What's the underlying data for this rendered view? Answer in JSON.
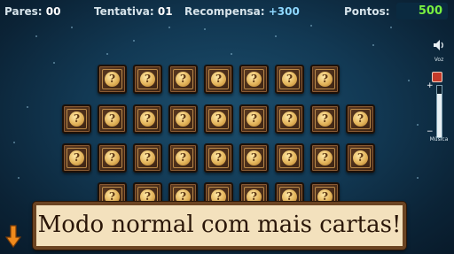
{
  "hud": {
    "pares_label": "Pares:",
    "pares_value": "00",
    "tentativa_label": "Tentativa:",
    "tentativa_value": "01",
    "recompensa_label": "Recompensa:",
    "recompensa_value": "+300",
    "pontos_label": "Pontos:",
    "pontos_value": "500"
  },
  "card_face": "?",
  "rows": [
    {
      "count": 7,
      "visible_fraction": 1
    },
    {
      "count": 9,
      "visible_fraction": 1
    },
    {
      "count": 9,
      "visible_fraction": 1
    },
    {
      "count": 7,
      "visible_fraction": 0.3
    }
  ],
  "side_controls": {
    "voz_label": "Voz",
    "musica_label": "Música",
    "music_level": 0.85
  },
  "banner_text": "Modo normal com mais cartas!",
  "colors": {
    "score_green": "#78f040",
    "reward_blue": "#8ed8ff",
    "arrow_orange": "#f08a1c"
  }
}
